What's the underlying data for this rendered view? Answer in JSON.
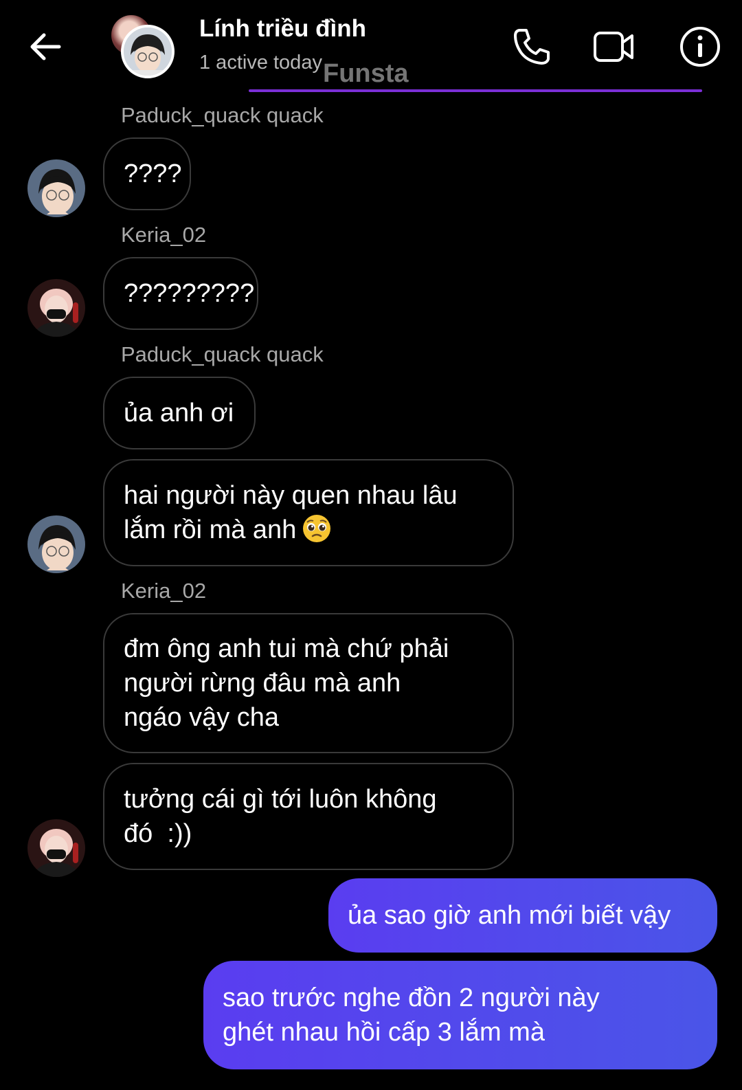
{
  "header": {
    "back_icon": "arrow-left-icon",
    "title": "Lính triều đình",
    "subtitle": "1 active today",
    "watermark": "Funsta",
    "actions": {
      "call_icon": "phone-icon",
      "video_icon": "video-camera-icon",
      "info_icon": "info-icon"
    }
  },
  "messages": [
    {
      "sender": "Paduck_quack quack",
      "text": "????"
    },
    {
      "sender": "Keria_02",
      "text": "?????????"
    },
    {
      "sender": "Paduck_quack quack",
      "text": "ủa anh ơi"
    },
    {
      "text": "hai người này quen nhau lâu\nlắm rồi mà anh",
      "emoji": "pleading-face-emoji"
    },
    {
      "sender": "Keria_02",
      "text": "đm ông anh tui mà chứ phải\nngười rừng đâu mà anh\nngáo vậy cha"
    },
    {
      "text": "tưởng cái gì tới luôn không\nđó  :))"
    },
    {
      "text": "ủa sao giờ anh mới biết vậy",
      "outgoing": true
    },
    {
      "text": "sao trước nghe đồn 2 người này\nghét nhau hồi cấp 3 lắm mà",
      "outgoing": true
    }
  ],
  "colors": {
    "background": "#000000",
    "outgoing_bubble": "#4f46e5",
    "incoming_border": "#3a3a3a",
    "watermark_line": "#7b2fd6"
  }
}
